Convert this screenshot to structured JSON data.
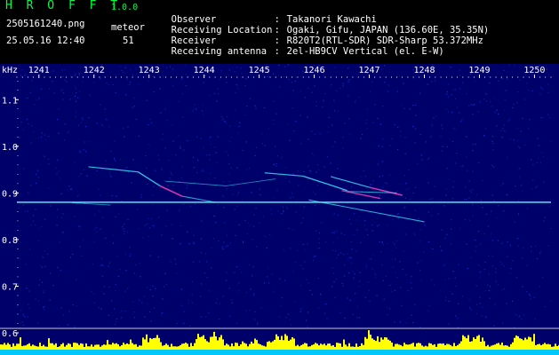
{
  "header": {
    "app_title": "H R O F F T",
    "version": "1.0.0",
    "filename": "2505161240.png",
    "datetime": "25.05.16 12:40",
    "meteor_label": "meteor",
    "meteor_count": "51",
    "info": [
      {
        "key": "Observer",
        "value": "Takanori Kawachi"
      },
      {
        "key": "Receiving Location",
        "value": "Ogaki, Gifu, JAPAN (136.60E, 35.35N)"
      },
      {
        "key": "Receiver",
        "value": "R820T2(RTL-SDR) SDR-Sharp 53.372MHz"
      },
      {
        "key": "Receiving antenna",
        "value": "2el-HB9CV Vertical (el. E-W)"
      }
    ],
    "separator": ":"
  },
  "chart_data": {
    "type": "heatmap",
    "yunit": "kHz",
    "x_ticks": [
      "1241",
      "1242",
      "1243",
      "1244",
      "1245",
      "1246",
      "1247",
      "1248",
      "1249",
      "1250"
    ],
    "y_ticks": [
      "1.1",
      "1.0",
      "0.9",
      "0.8",
      "0.7",
      "0.6"
    ],
    "xlim": [
      1240.6,
      1250.3
    ],
    "ylim": [
      0.6,
      1.15
    ],
    "carrier_khz": 0.88,
    "colors": {
      "background": "#00006a",
      "noise": "#1838d8",
      "trace": "#38e8ff",
      "hot": "#ff40c0",
      "carrier": "#60ffff",
      "bar": "#ffff00",
      "base": "#00c8ff"
    }
  }
}
